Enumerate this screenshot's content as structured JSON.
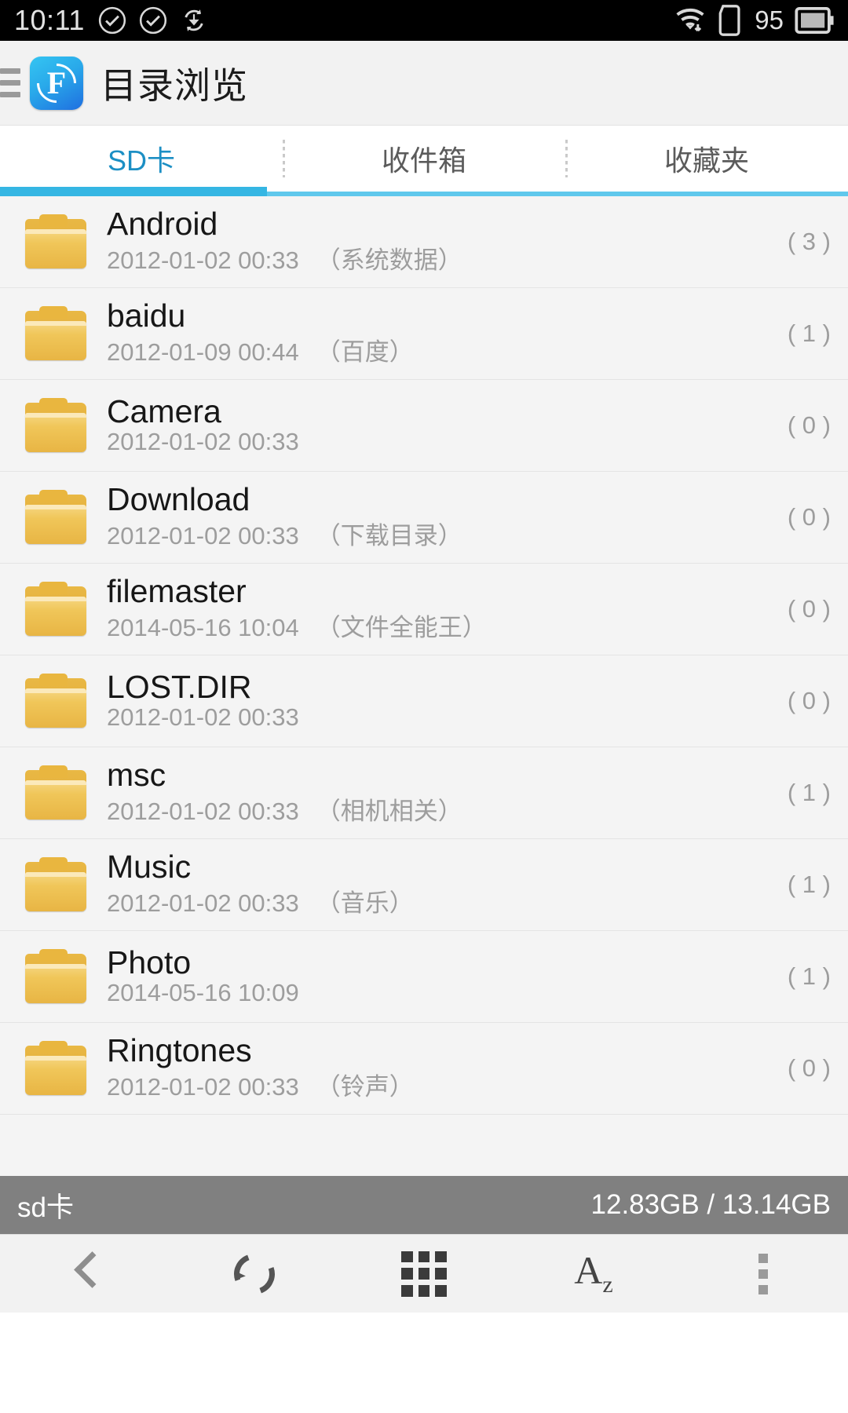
{
  "status_bar": {
    "clock": "10:11",
    "battery_level": "95",
    "icons": [
      "check-circle-icon",
      "check-circle-icon",
      "sync-download-icon",
      "wifi-icon",
      "sd-card-icon",
      "battery-icon"
    ]
  },
  "app_bar": {
    "drawer_icon": "hamburger-menu-icon",
    "app_icon_letter": "F",
    "title": "目录浏览"
  },
  "tabs": {
    "items": [
      {
        "label": "SD卡",
        "active": true
      },
      {
        "label": "收件箱",
        "active": false
      },
      {
        "label": "收藏夹",
        "active": false
      }
    ],
    "indicator_color": "#35b6e3",
    "active_text_color": "#1c8fc4"
  },
  "file_list": {
    "rows": [
      {
        "name": "Android",
        "date": "2012-01-02 00:33",
        "desc": "（系统数据）",
        "count": "( 3 )"
      },
      {
        "name": "baidu",
        "date": "2012-01-09 00:44",
        "desc": "（百度）",
        "count": "( 1 )"
      },
      {
        "name": "Camera",
        "date": "2012-01-02 00:33",
        "desc": "",
        "count": "( 0 )"
      },
      {
        "name": "Download",
        "date": "2012-01-02 00:33",
        "desc": "（下载目录）",
        "count": "( 0 )"
      },
      {
        "name": "filemaster",
        "date": "2014-05-16 10:04",
        "desc": "（文件全能王）",
        "count": "( 0 )"
      },
      {
        "name": "LOST.DIR",
        "date": "2012-01-02 00:33",
        "desc": "",
        "count": "( 0 )"
      },
      {
        "name": "msc",
        "date": "2012-01-02 00:33",
        "desc": "（相机相关）",
        "count": "( 1 )"
      },
      {
        "name": "Music",
        "date": "2012-01-02 00:33",
        "desc": "（音乐）",
        "count": "( 1 )"
      },
      {
        "name": "Photo",
        "date": "2014-05-16 10:09",
        "desc": "",
        "count": "( 1 )"
      },
      {
        "name": "Ringtones",
        "date": "2012-01-02 00:33",
        "desc": "（铃声）",
        "count": "( 0 )"
      }
    ]
  },
  "storage_bar": {
    "label": "sd卡",
    "usage": "12.83GB / 13.14GB",
    "background": "#808080"
  },
  "toolbar": {
    "buttons": [
      {
        "name": "back-button",
        "icon": "chevron-left-icon"
      },
      {
        "name": "refresh-button",
        "icon": "refresh-icon"
      },
      {
        "name": "grid-view-button",
        "icon": "grid-icon"
      },
      {
        "name": "sort-button",
        "icon": "az-sort-icon",
        "label": "A",
        "sub": "z"
      },
      {
        "name": "more-button",
        "icon": "overflow-dots-icon"
      }
    ]
  }
}
